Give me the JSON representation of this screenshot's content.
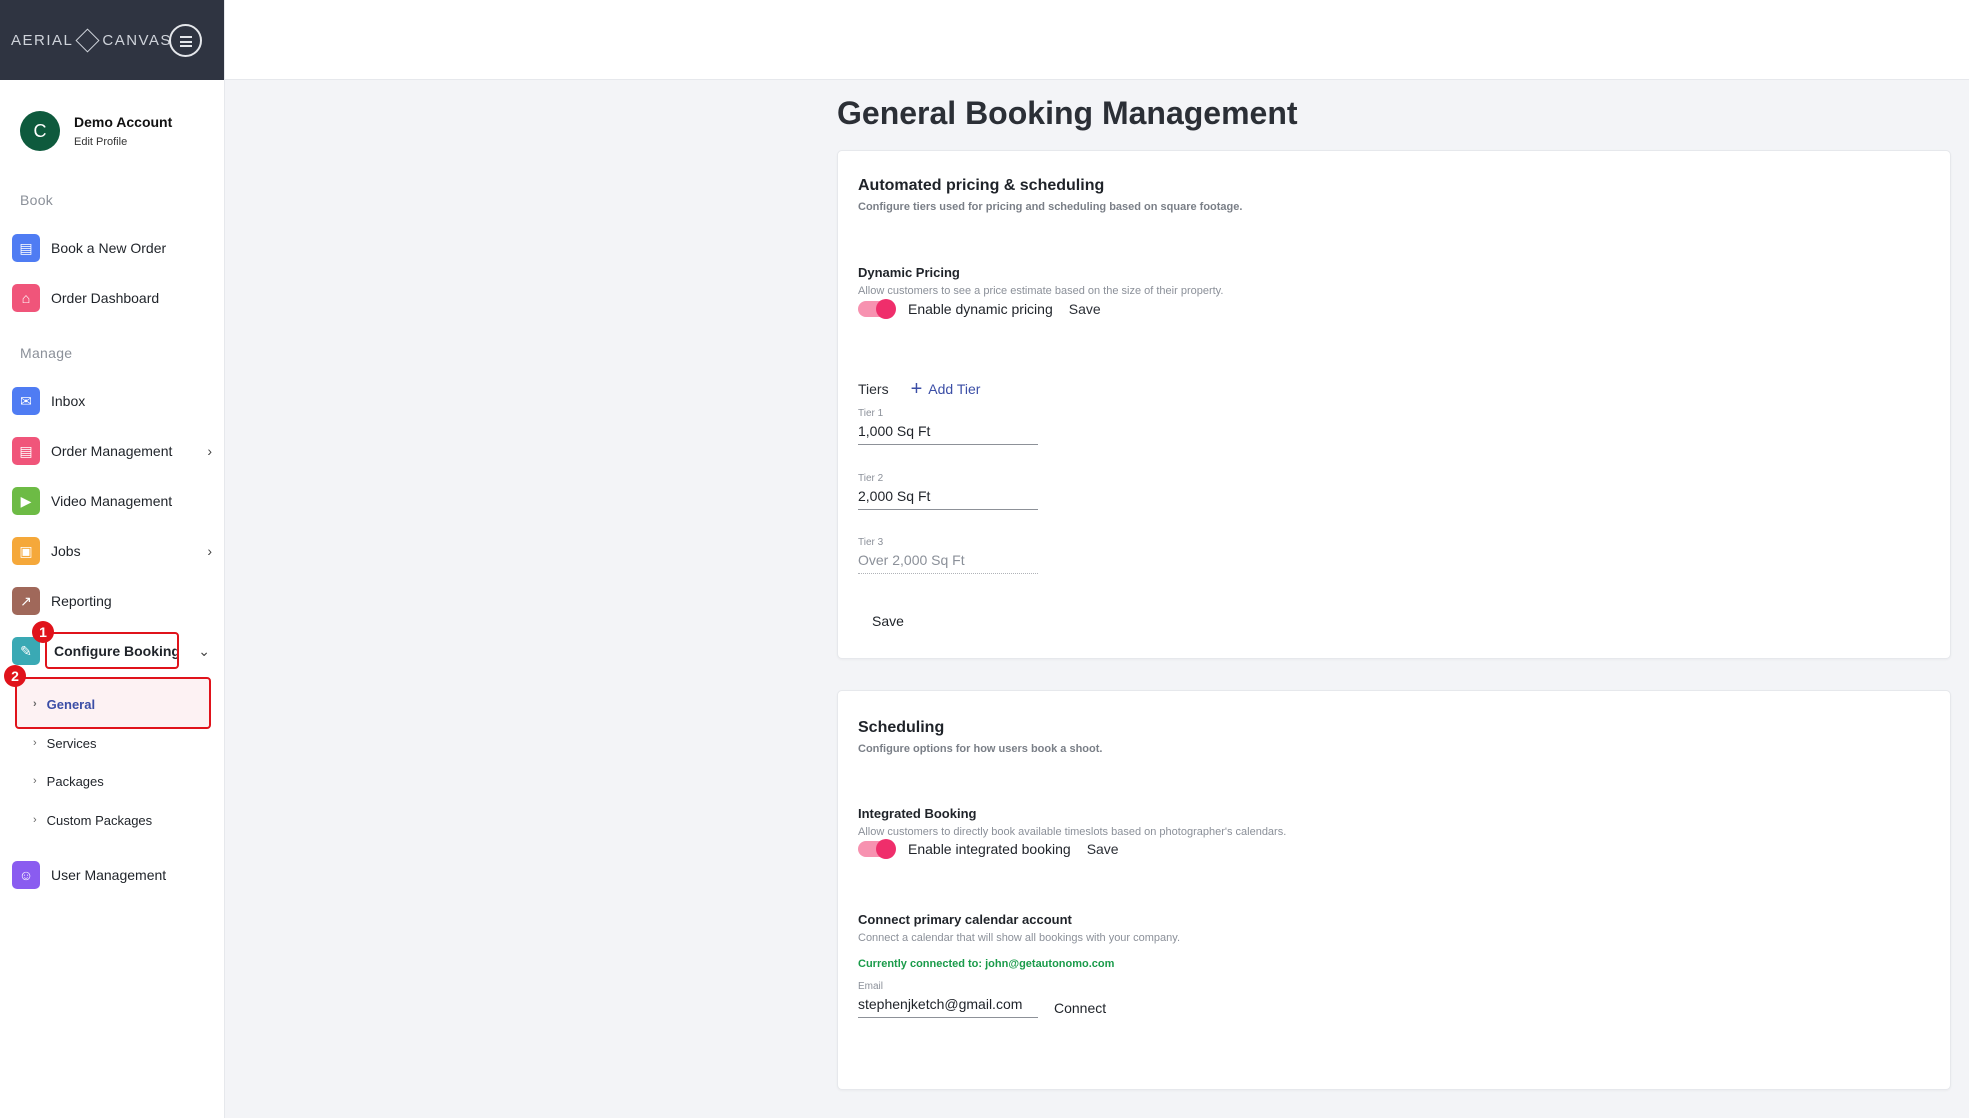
{
  "brand": {
    "left": "AERIAL",
    "right": "CANVAS"
  },
  "profile": {
    "initial": "C",
    "name": "Demo Account",
    "edit": "Edit Profile"
  },
  "sidebar": {
    "book_label": "Book",
    "manage_label": "Manage",
    "items": [
      {
        "label": "Book a New Order",
        "icon": "order-form-icon",
        "color": "#4f7cf3"
      },
      {
        "label": "Order Dashboard",
        "icon": "home-icon",
        "color": "#f0557a"
      },
      {
        "label": "Inbox",
        "icon": "mail-icon",
        "color": "#4f7cf3"
      },
      {
        "label": "Order Management",
        "icon": "orders-icon",
        "color": "#f0557a"
      },
      {
        "label": "Video Management",
        "icon": "video-icon",
        "color": "#6dbb45"
      },
      {
        "label": "Jobs",
        "icon": "briefcase-icon",
        "color": "#f5a83a"
      },
      {
        "label": "Reporting",
        "icon": "chart-icon",
        "color": "#a0685a"
      },
      {
        "label": "Configure Booking",
        "icon": "wand-icon",
        "color": "#3aa9b4"
      },
      {
        "label": "User Management",
        "icon": "user-icon",
        "color": "#8a5cf0"
      }
    ],
    "sub_items": [
      "General",
      "Services",
      "Packages",
      "Custom Packages"
    ],
    "badges": [
      "1",
      "2"
    ]
  },
  "main": {
    "title": "General Booking Management",
    "pricing": {
      "title": "Automated pricing & scheduling",
      "subtitle": "Configure tiers used for pricing and scheduling based on square footage.",
      "dynamic_title": "Dynamic Pricing",
      "dynamic_desc": "Allow customers to see a price estimate based on the size of their property.",
      "toggle_label": "Enable dynamic pricing",
      "toggle_on": true,
      "save": "Save",
      "tiers_label": "Tiers",
      "add_tier": "Add Tier",
      "tiers": [
        {
          "label": "Tier 1",
          "value": "1,000 Sq Ft"
        },
        {
          "label": "Tier 2",
          "value": "2,000 Sq Ft"
        },
        {
          "label": "Tier 3",
          "value": "Over 2,000 Sq Ft"
        }
      ],
      "save_bottom": "Save"
    },
    "scheduling": {
      "title": "Scheduling",
      "subtitle": "Configure options for how users book a shoot.",
      "integrated_title": "Integrated Booking",
      "integrated_desc": "Allow customers to directly book available timeslots based on photographer's calendars.",
      "toggle_label": "Enable integrated booking",
      "toggle_on": true,
      "save": "Save",
      "calendar_title": "Connect primary calendar account",
      "calendar_desc": "Connect a calendar that will show all bookings with your company.",
      "connected": "Currently connected to: john@getautonomo.com",
      "email_label": "Email",
      "email_value": "stephenjketch@gmail.com",
      "connect": "Connect"
    }
  }
}
